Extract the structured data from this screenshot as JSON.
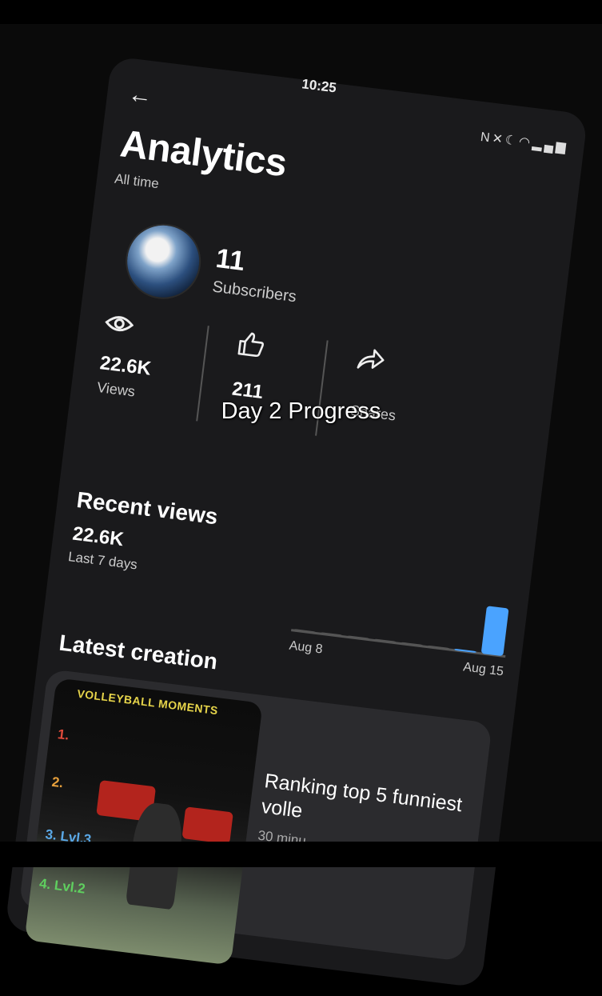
{
  "status_bar": {
    "time": "10:25",
    "icons": [
      "nfc-icon",
      "mute-icon",
      "moon-icon",
      "wifi-icon",
      "signal-icon"
    ]
  },
  "header": {
    "title": "Analytics",
    "subtitle": "All time"
  },
  "channel": {
    "subscribers_value": "11",
    "subscribers_label": "Subscribers"
  },
  "stats": [
    {
      "icon": "eye-icon",
      "value": "22.6K",
      "label": "Views"
    },
    {
      "icon": "thumbs-up-icon",
      "value": "211",
      "label": ""
    },
    {
      "icon": "share-icon",
      "value": "",
      "label": "Shares"
    }
  ],
  "recent_views": {
    "title": "Recent views",
    "value": "22.6K",
    "period": "Last 7 days",
    "start_label": "Aug 8",
    "end_label": "Aug 15",
    "accent": "#4aa3ff"
  },
  "chart_data": {
    "type": "bar",
    "categories": [
      "Aug 8",
      "",
      "",
      "",
      "",
      "",
      "",
      "Aug 15"
    ],
    "values": [
      0,
      0,
      0,
      0,
      0,
      0,
      300,
      22300
    ],
    "title": "",
    "xlabel": "",
    "ylabel": ""
  },
  "latest_creation": {
    "title": "Latest creation",
    "video_title": "Ranking top 5 funniest volle",
    "video_meta": "30 minu",
    "thumbnail": {
      "banner": "VOLLEYBALL MOMENTS",
      "ranks": [
        "1.",
        "2.",
        "3. Lvl.3",
        "4. Lvl.2"
      ]
    }
  },
  "overlay_caption": "Day 2 Progress"
}
